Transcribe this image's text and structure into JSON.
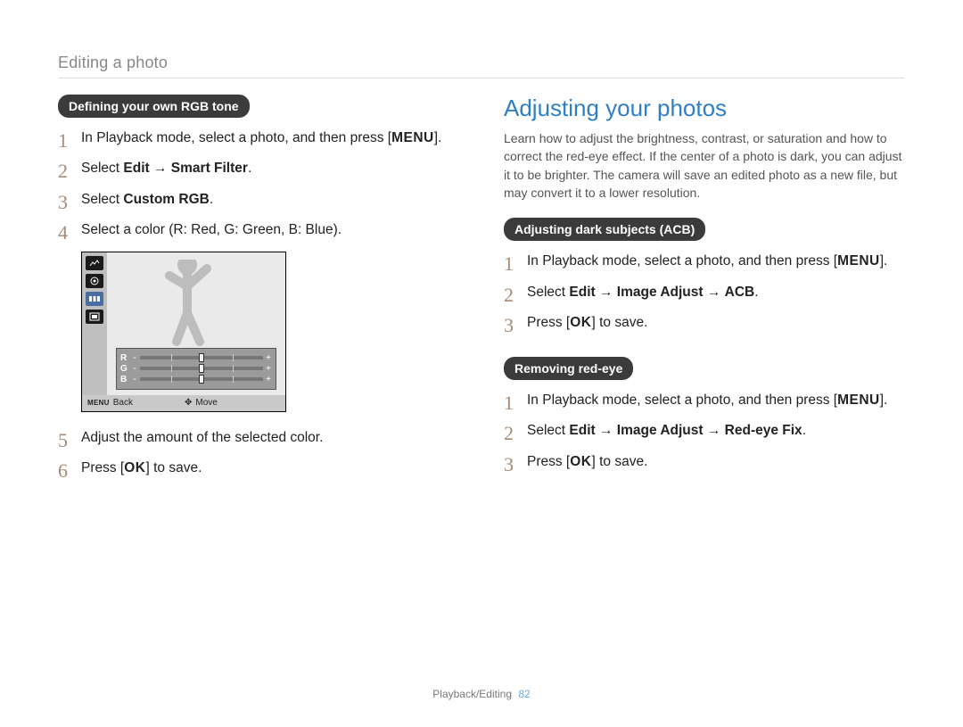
{
  "breadcrumb": "Editing a photo",
  "left": {
    "pill": "Defining your own RGB tone",
    "steps1": {
      "s1a": "In Playback mode, select a photo, and then press [",
      "s1_menu": "MENU",
      "s1b": "].",
      "s2a": "Select ",
      "s2_edit": "Edit",
      "s2_arrow": " → ",
      "s2_sf": "Smart Filter",
      "s2b": ".",
      "s3a": "Select ",
      "s3_crgb": "Custom RGB",
      "s3b": ".",
      "s4": "Select a color (R: Red, G: Green, B: Blue)."
    },
    "illus": {
      "rgb_labels": {
        "r": "R",
        "g": "G",
        "b": "B"
      },
      "minus": "-",
      "plus": "+",
      "footer": {
        "menu": "MENU",
        "back": "Back",
        "move": "Move"
      }
    },
    "steps2": {
      "s5": "Adjust the amount of the selected color.",
      "s6a": "Press [",
      "s6_ok": "OK",
      "s6b": "] to save."
    }
  },
  "right": {
    "heading": "Adjusting your photos",
    "intro": "Learn how to adjust the brightness, contrast, or saturation and how to correct the red-eye effect. If the center of a photo is dark, you can adjust it to be brighter. The camera will save an edited photo as a new file, but may convert it to a lower resolution.",
    "acb": {
      "pill": "Adjusting dark subjects (ACB)",
      "s1a": "In Playback mode, select a photo, and then press [",
      "s1_menu": "MENU",
      "s1b": "].",
      "s2a": "Select ",
      "s2_edit": "Edit",
      "s2_arr1": " → ",
      "s2_ia": "Image Adjust",
      "s2_arr2": " → ",
      "s2_acb": "ACB",
      "s2b": ".",
      "s3a": "Press [",
      "s3_ok": "OK",
      "s3b": "] to save."
    },
    "redeye": {
      "pill": "Removing red-eye",
      "s1a": "In Playback mode, select a photo, and then press [",
      "s1_menu": "MENU",
      "s1b": "].",
      "s2a": "Select ",
      "s2_edit": "Edit",
      "s2_arr1": " → ",
      "s2_ia": "Image Adjust",
      "s2_arr2": " → ",
      "s2_ref": "Red-eye Fix",
      "s2b": ".",
      "s3a": "Press [",
      "s3_ok": "OK",
      "s3b": "] to save."
    }
  },
  "footer": {
    "section": "Playback/Editing",
    "page": "82"
  }
}
